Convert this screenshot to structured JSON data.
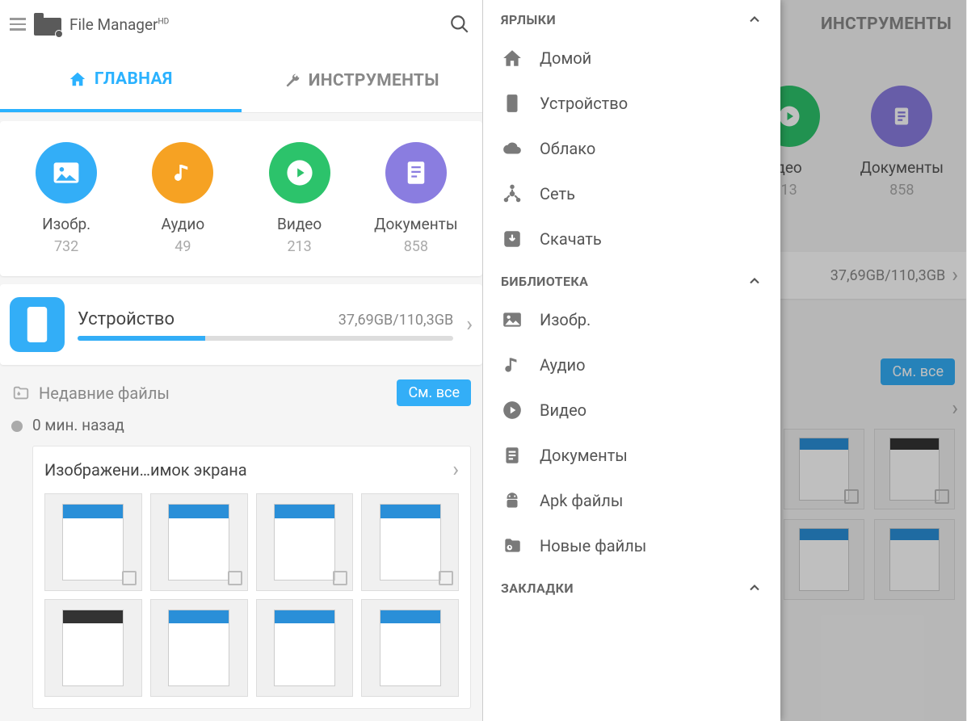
{
  "app": {
    "title": "File Manager",
    "superscript": "HD"
  },
  "tabs": {
    "home": "ГЛАВНАЯ",
    "tools": "ИНСТРУМЕНТЫ"
  },
  "categories": [
    {
      "key": "images",
      "label": "Изобр.",
      "count": "732",
      "color": "#33aef7",
      "icon": "image"
    },
    {
      "key": "audio",
      "label": "Аудио",
      "count": "49",
      "color": "#f6a223",
      "icon": "music"
    },
    {
      "key": "video",
      "label": "Видео",
      "count": "213",
      "color": "#2cc36b",
      "icon": "play"
    },
    {
      "key": "documents",
      "label": "Документы",
      "count": "858",
      "color": "#8a7de0",
      "icon": "doc"
    }
  ],
  "storage": {
    "title": "Устройство",
    "value": "37,69GB/110,3GB",
    "fill_pct": 34
  },
  "recent": {
    "title": "Недавние файлы",
    "see_all": "См. все",
    "time": "0 мин. назад",
    "group_title": "Изображени…имок экрана"
  },
  "drawer": {
    "sections": [
      {
        "key": "shortcuts",
        "title": "ЯРЛЫКИ",
        "items": [
          {
            "label": "Домой",
            "icon": "home"
          },
          {
            "label": "Устройство",
            "icon": "phone"
          },
          {
            "label": "Облако",
            "icon": "cloud"
          },
          {
            "label": "Сеть",
            "icon": "network"
          },
          {
            "label": "Скачать",
            "icon": "download"
          }
        ]
      },
      {
        "key": "library",
        "title": "БИБЛИОТЕКА",
        "items": [
          {
            "label": "Изобр.",
            "icon": "image"
          },
          {
            "label": "Аудио",
            "icon": "music"
          },
          {
            "label": "Видео",
            "icon": "play-c"
          },
          {
            "label": "Документы",
            "icon": "doc"
          },
          {
            "label": "Apk файлы",
            "icon": "android"
          },
          {
            "label": "Новые файлы",
            "icon": "recent"
          }
        ]
      },
      {
        "key": "bookmarks",
        "title": "ЗАКЛАДКИ",
        "items": []
      }
    ]
  },
  "right_bg": {
    "tools_tab": "ИНСТРУМЕНТЫ",
    "video_label": "део",
    "video_count": "13",
    "docs_label": "Документы",
    "docs_count": "858",
    "storage_value": "37,69GB/110,3GB",
    "see_all": "См. все"
  }
}
